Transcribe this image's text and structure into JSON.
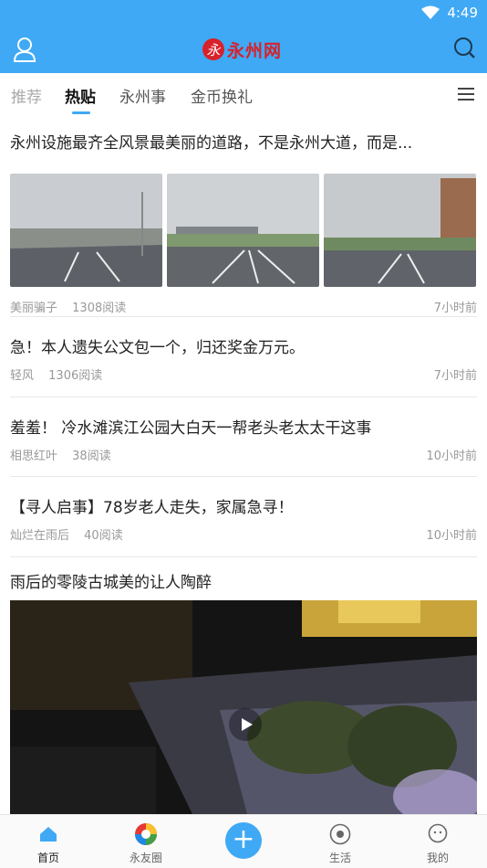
{
  "status": {
    "time": "4:49"
  },
  "header": {
    "logo_mark": "永",
    "logo_text": "永州网"
  },
  "tabs": [
    {
      "label": "推荐"
    },
    {
      "label": "热贴"
    },
    {
      "label": "永州事"
    },
    {
      "label": "金币换礼"
    }
  ],
  "articles": [
    {
      "title": "永州设施最齐全风景最美丽的道路，不是永州大道，而是...",
      "author": "美丽骗子",
      "reads": "1308阅读",
      "time": "7小时前"
    },
    {
      "title": "急！本人遗失公文包一个，归还奖金万元。",
      "author": "轻风",
      "reads": "1306阅读",
      "time": "7小时前"
    },
    {
      "title": "羞羞！ 冷水滩滨江公园大白天一帮老头老太太干这事",
      "author": "相思红叶",
      "reads": "38阅读",
      "time": "10小时前"
    },
    {
      "title": "【寻人启事】78岁老人走失，家属急寻！",
      "author": "灿烂在雨后",
      "reads": "40阅读",
      "time": "10小时前"
    },
    {
      "title": "雨后的零陵古城美的让人陶醉"
    }
  ],
  "bottom_nav": [
    {
      "label": "首页"
    },
    {
      "label": "永友圈"
    },
    {
      "label": "生活"
    },
    {
      "label": "我的"
    }
  ],
  "fab": {
    "symbol": "+"
  },
  "colors": {
    "accent": "#3fa9f5",
    "logo_red": "#d8212b"
  }
}
